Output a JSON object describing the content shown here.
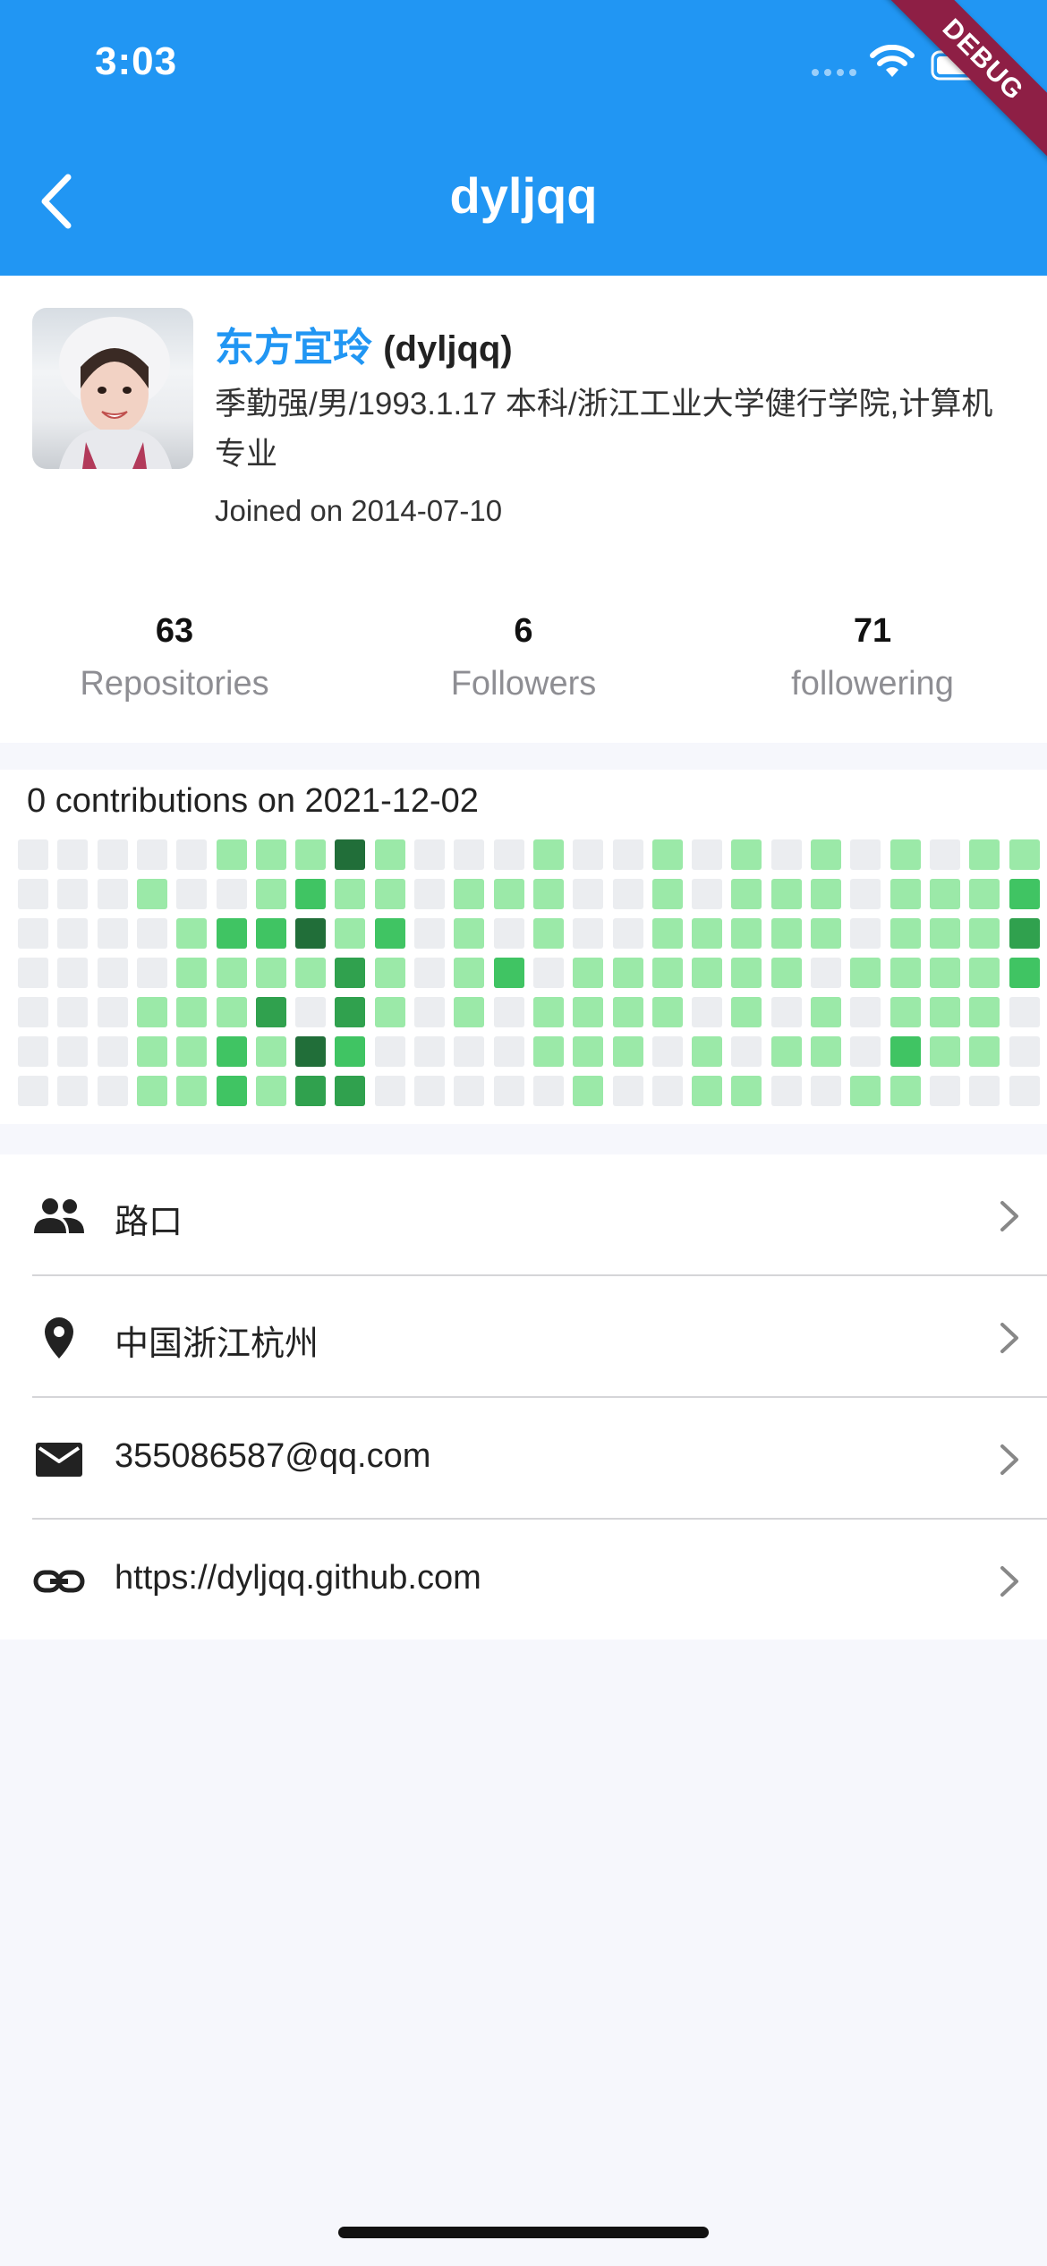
{
  "status_bar": {
    "time": "3:03"
  },
  "debug_banner": "DEBUG",
  "app_bar": {
    "title": "dyljqq"
  },
  "profile": {
    "nickname": "东方宜玲",
    "login": "(dyljqq)",
    "bio": "季勤强/男/1993.1.17 本科/浙江工业大学健行学院,计算机专业",
    "joined": "Joined on 2014-07-10"
  },
  "stats": [
    {
      "value": "63",
      "label": "Repositories"
    },
    {
      "value": "6",
      "label": "Followers"
    },
    {
      "value": "71",
      "label": "followering"
    }
  ],
  "contributions": {
    "title": "0 contributions on 2021-12-02",
    "levels_legend": {
      "0": "#ebedf0",
      "1": "#9be9a8",
      "2": "#40c463",
      "3": "#30a14e",
      "4": "#216e39"
    },
    "weeks": [
      [
        0,
        0,
        0,
        0,
        0,
        0,
        0
      ],
      [
        0,
        0,
        0,
        0,
        0,
        0,
        0
      ],
      [
        0,
        0,
        0,
        0,
        0,
        0,
        0
      ],
      [
        0,
        1,
        0,
        0,
        1,
        1,
        1
      ],
      [
        0,
        0,
        1,
        1,
        1,
        1,
        1
      ],
      [
        1,
        0,
        2,
        1,
        1,
        2,
        2
      ],
      [
        1,
        1,
        2,
        1,
        3,
        1,
        1
      ],
      [
        1,
        2,
        4,
        1,
        0,
        4,
        3
      ],
      [
        4,
        1,
        1,
        3,
        3,
        2,
        3
      ],
      [
        1,
        1,
        2,
        1,
        1,
        0,
        0
      ],
      [
        0,
        0,
        0,
        0,
        0,
        0,
        0
      ],
      [
        0,
        1,
        1,
        1,
        1,
        0,
        0
      ],
      [
        0,
        1,
        0,
        2,
        0,
        0,
        0
      ],
      [
        1,
        1,
        1,
        0,
        1,
        1,
        0
      ],
      [
        0,
        0,
        0,
        1,
        1,
        1,
        1
      ],
      [
        0,
        0,
        0,
        1,
        1,
        1,
        0
      ],
      [
        1,
        1,
        1,
        1,
        1,
        0,
        0
      ],
      [
        0,
        0,
        1,
        1,
        0,
        1,
        1
      ],
      [
        1,
        1,
        1,
        1,
        1,
        0,
        1
      ],
      [
        0,
        1,
        1,
        1,
        0,
        1,
        0
      ],
      [
        1,
        1,
        1,
        0,
        1,
        1,
        0
      ],
      [
        0,
        0,
        0,
        1,
        0,
        0,
        1
      ],
      [
        1,
        1,
        1,
        1,
        1,
        2,
        1
      ],
      [
        0,
        1,
        1,
        1,
        1,
        1,
        0
      ],
      [
        1,
        1,
        1,
        1,
        1,
        1,
        0
      ],
      [
        1,
        2,
        3,
        2,
        0,
        0,
        0
      ]
    ]
  },
  "info_rows": [
    {
      "icon": "people-icon",
      "text": "路口"
    },
    {
      "icon": "location-pin-icon",
      "text": "中国浙江杭州"
    },
    {
      "icon": "mail-icon",
      "text": "355086587@qq.com"
    },
    {
      "icon": "link-icon",
      "text": "https://dyljqq.github.com"
    }
  ]
}
